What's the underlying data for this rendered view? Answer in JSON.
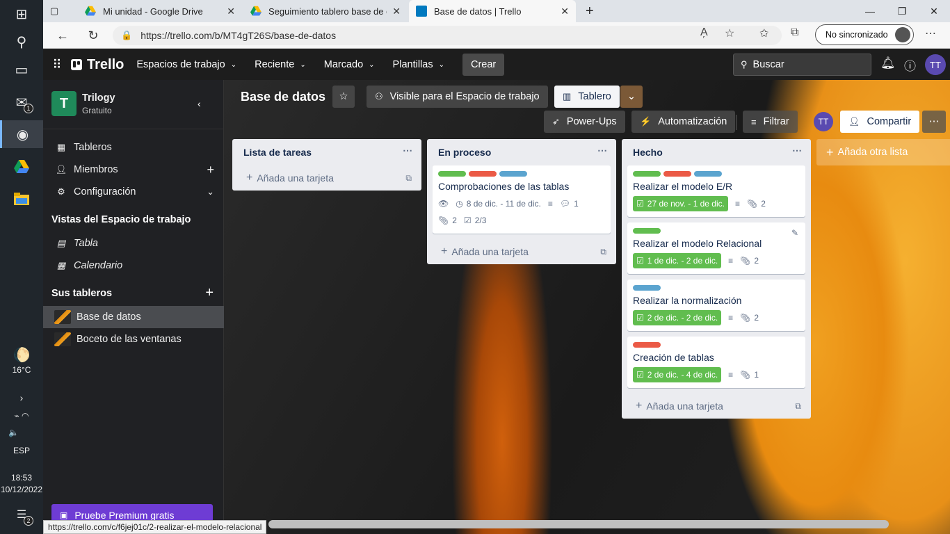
{
  "taskbar": {
    "mail_badge": "1",
    "weather_temp": "16°C",
    "language": "ESP",
    "time": "18:53",
    "date": "10/12/2022",
    "notif_badge": "2"
  },
  "browser": {
    "tabs": [
      {
        "title": "Mi unidad - Google Drive",
        "icon": "google-drive-icon",
        "active": false
      },
      {
        "title": "Seguimiento tablero base de dat",
        "icon": "google-drive-icon",
        "active": false
      },
      {
        "title": "Base de datos | Trello",
        "icon": "trello-icon",
        "active": true
      }
    ],
    "url": "https://trello.com/b/MT4gT26S/base-de-datos",
    "sync_label": "No sincronizado",
    "status_url": "https://trello.com/c/f6jej01c/2-realizar-el-modelo-relacional"
  },
  "header": {
    "logo": "Trello",
    "menus": [
      "Espacios de trabajo",
      "Reciente",
      "Marcado",
      "Plantillas"
    ],
    "create": "Crear",
    "search_placeholder": "Buscar",
    "avatar": "TT"
  },
  "sidebar": {
    "workspace_initial": "T",
    "workspace_name": "Trilogy",
    "workspace_plan": "Gratuito",
    "items": [
      "Tableros",
      "Miembros",
      "Configuración"
    ],
    "views_title": "Vistas del Espacio de trabajo",
    "views": [
      "Tabla",
      "Calendario"
    ],
    "boards_title": "Sus tableros",
    "boards": [
      "Base de datos",
      "Boceto de las ventanas"
    ],
    "premium": "Pruebe Premium gratis"
  },
  "board": {
    "title": "Base de datos",
    "visibility": "Visible para el Espacio de trabajo",
    "view": "Tablero",
    "powerups": "Power-Ups",
    "automation": "Automatización",
    "filter": "Filtrar",
    "avatar": "TT",
    "share": "Compartir",
    "add_list": "Añada otra lista",
    "add_card": "Añada una tarjeta",
    "lists": [
      {
        "title": "Lista de tareas",
        "cards": []
      },
      {
        "title": "En proceso",
        "cards": [
          {
            "labels": [
              "#61bd4f",
              "#eb5a46",
              "#5ba4cf"
            ],
            "title": "Comprobaciones de las tablas",
            "due": "8 de dic. - 11 de dic.",
            "comments": "1",
            "attachments": "2",
            "checklist": "2/3"
          }
        ]
      },
      {
        "title": "Hecho",
        "cards": [
          {
            "labels": [
              "#61bd4f",
              "#eb5a46",
              "#5ba4cf"
            ],
            "title": "Realizar el modelo E/R",
            "due": "27 de nov. - 1 de dic.",
            "attachments": "2"
          },
          {
            "labels": [
              "#61bd4f"
            ],
            "title": "Realizar el modelo Relacional",
            "due": "1 de dic. - 2 de dic.",
            "attachments": "2"
          },
          {
            "labels": [
              "#5ba4cf"
            ],
            "title": "Realizar la normalización",
            "due": "2 de dic. - 2 de dic.",
            "attachments": "2"
          },
          {
            "labels": [
              "#eb5a46"
            ],
            "title": "Creación de tablas",
            "due": "2 de dic. - 4 de dic.",
            "attachments": "1"
          }
        ]
      }
    ]
  }
}
